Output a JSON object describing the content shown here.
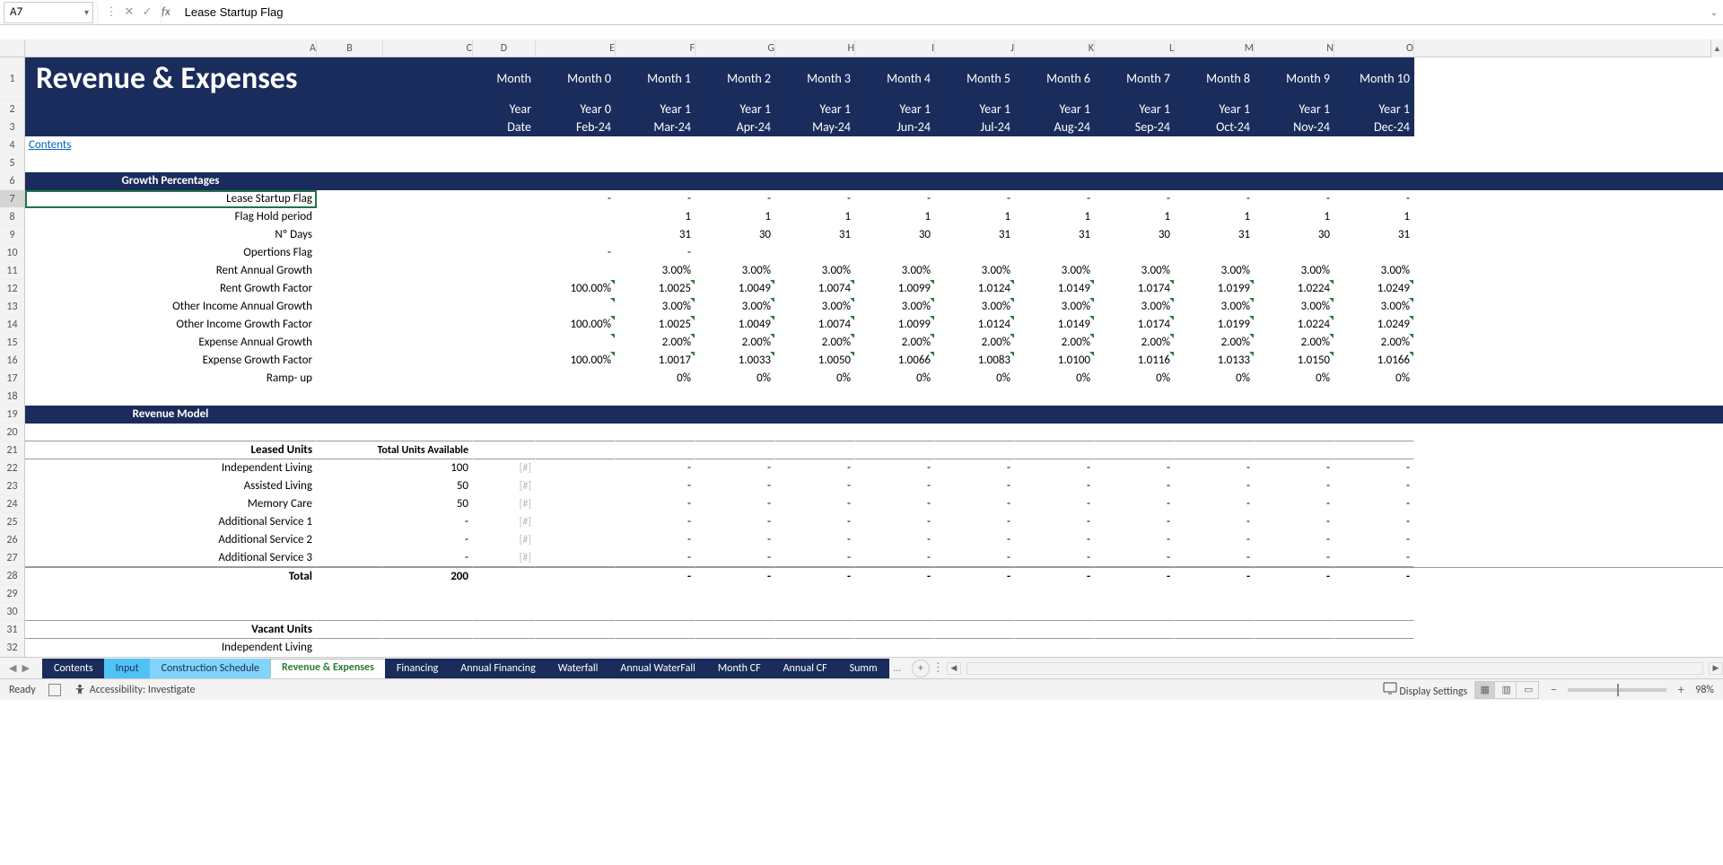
{
  "nameBox": "A7",
  "formulaBar": "Lease Startup Flag",
  "columns": [
    "A",
    "B",
    "C",
    "D",
    "E",
    "F",
    "G",
    "H",
    "I",
    "J",
    "K",
    "L",
    "M",
    "N",
    "O"
  ],
  "rowNumbers": [
    1,
    2,
    3,
    4,
    5,
    6,
    7,
    8,
    9,
    10,
    11,
    12,
    13,
    14,
    15,
    16,
    17,
    18,
    19,
    20,
    21,
    22,
    23,
    24,
    25,
    26,
    27,
    28,
    29,
    30,
    31,
    32
  ],
  "title": "Revenue & Expenses",
  "monthLabel": "Month",
  "yearLabel": "Year",
  "dateLabel": "Date",
  "months": [
    "Month 0",
    "Month 1",
    "Month 2",
    "Month 3",
    "Month 4",
    "Month 5",
    "Month 6",
    "Month 7",
    "Month 8",
    "Month 9",
    "Month 10"
  ],
  "years": [
    "Year 0",
    "Year 1",
    "Year 1",
    "Year 1",
    "Year 1",
    "Year 1",
    "Year 1",
    "Year 1",
    "Year 1",
    "Year 1",
    "Year 1"
  ],
  "dates": [
    "Feb-24",
    "Mar-24",
    "Apr-24",
    "May-24",
    "Jun-24",
    "Jul-24",
    "Aug-24",
    "Sep-24",
    "Oct-24",
    "Nov-24",
    "Dec-24"
  ],
  "contentsLink": "Contents",
  "sectionGrowth": "Growth Percentages",
  "sectionRevenue": "Revenue Model",
  "rowsGrowth": {
    "leaseStartup": {
      "label": "Lease Startup Flag",
      "E": "-",
      "vals": [
        "-",
        "-",
        "-",
        "-",
        "-",
        "-",
        "-",
        "-",
        "-",
        "-"
      ]
    },
    "flagHold": {
      "label": "Flag Hold period",
      "E": "",
      "vals": [
        "1",
        "1",
        "1",
        "1",
        "1",
        "1",
        "1",
        "1",
        "1",
        "1"
      ]
    },
    "days": {
      "label": "Nº Days",
      "E": "",
      "vals": [
        "31",
        "30",
        "31",
        "30",
        "31",
        "31",
        "30",
        "31",
        "30",
        "31"
      ]
    },
    "opsFlag": {
      "label": "Opertions Flag",
      "E": "-",
      "vals": [
        "-",
        "",
        "",
        "",
        "",
        "",
        "",
        "",
        "",
        ""
      ]
    },
    "rentAnn": {
      "label": "Rent Annual Growth",
      "E": "",
      "vals": [
        "3.00%",
        "3.00%",
        "3.00%",
        "3.00%",
        "3.00%",
        "3.00%",
        "3.00%",
        "3.00%",
        "3.00%",
        "3.00%"
      ]
    },
    "rentFactor": {
      "label": "Rent Growth Factor",
      "E": "100.00%",
      "vals": [
        "1.0025",
        "1.0049",
        "1.0074",
        "1.0099",
        "1.0124",
        "1.0149",
        "1.0174",
        "1.0199",
        "1.0224",
        "1.0249"
      ]
    },
    "otherAnn": {
      "label": "Other Income Annual Growth",
      "E": "",
      "vals": [
        "3.00%",
        "3.00%",
        "3.00%",
        "3.00%",
        "3.00%",
        "3.00%",
        "3.00%",
        "3.00%",
        "3.00%",
        "3.00%"
      ]
    },
    "otherFactor": {
      "label": "Other Income Growth Factor",
      "E": "100.00%",
      "vals": [
        "1.0025",
        "1.0049",
        "1.0074",
        "1.0099",
        "1.0124",
        "1.0149",
        "1.0174",
        "1.0199",
        "1.0224",
        "1.0249"
      ]
    },
    "expAnn": {
      "label": "Expense Annual Growth",
      "E": "",
      "vals": [
        "2.00%",
        "2.00%",
        "2.00%",
        "2.00%",
        "2.00%",
        "2.00%",
        "2.00%",
        "2.00%",
        "2.00%",
        "2.00%"
      ]
    },
    "expFactor": {
      "label": "Expense Growth Factor",
      "E": "100.00%",
      "vals": [
        "1.0017",
        "1.0033",
        "1.0050",
        "1.0066",
        "1.0083",
        "1.0100",
        "1.0116",
        "1.0133",
        "1.0150",
        "1.0166"
      ]
    },
    "ramp": {
      "label": "Ramp- up",
      "E": "",
      "vals": [
        "0%",
        "0%",
        "0%",
        "0%",
        "0%",
        "0%",
        "0%",
        "0%",
        "0%",
        "0%"
      ]
    }
  },
  "leasedHeader": "Leased Units",
  "totalUnitsHeader": "Total Units Available",
  "leasedRows": [
    {
      "label": "Independent Living",
      "C": "100",
      "D": "[#]",
      "vals": [
        "-",
        "-",
        "-",
        "-",
        "-",
        "-",
        "-",
        "-",
        "-",
        "-"
      ]
    },
    {
      "label": "Assisted Living",
      "C": "50",
      "D": "[#]",
      "vals": [
        "-",
        "-",
        "-",
        "-",
        "-",
        "-",
        "-",
        "-",
        "-",
        "-"
      ]
    },
    {
      "label": "Memory Care",
      "C": "50",
      "D": "[#]",
      "vals": [
        "-",
        "-",
        "-",
        "-",
        "-",
        "-",
        "-",
        "-",
        "-",
        "-"
      ]
    },
    {
      "label": "Additional Service 1",
      "C": "-",
      "D": "[#]",
      "vals": [
        "-",
        "-",
        "-",
        "-",
        "-",
        "-",
        "-",
        "-",
        "-",
        "-"
      ]
    },
    {
      "label": "Additional Service 2",
      "C": "-",
      "D": "[#]",
      "vals": [
        "-",
        "-",
        "-",
        "-",
        "-",
        "-",
        "-",
        "-",
        "-",
        "-"
      ]
    },
    {
      "label": "Additional Service 3",
      "C": "-",
      "D": "[#]",
      "vals": [
        "-",
        "-",
        "-",
        "-",
        "-",
        "-",
        "-",
        "-",
        "-",
        "-"
      ]
    }
  ],
  "totalLabel": "Total",
  "totalC": "200",
  "totalVals": [
    "-",
    "-",
    "-",
    "-",
    "-",
    "-",
    "-",
    "-",
    "-",
    "-"
  ],
  "vacantHeader": "Vacant Units",
  "vacantRow32": "Independent Living",
  "tabs": {
    "contents": "Contents",
    "input": "Input",
    "constr": "Construction Schedule",
    "active": "Revenue & Expenses",
    "financing": "Financing",
    "annFin": "Annual Financing",
    "waterfall": "Waterfall",
    "annWater": "Annual WaterFall",
    "monthCF": "Month CF",
    "annCF": "Annual CF",
    "summ": "Summ"
  },
  "status": {
    "ready": "Ready",
    "accessibility": "Accessibility: Investigate",
    "display": "Display Settings",
    "zoom": "98%"
  }
}
